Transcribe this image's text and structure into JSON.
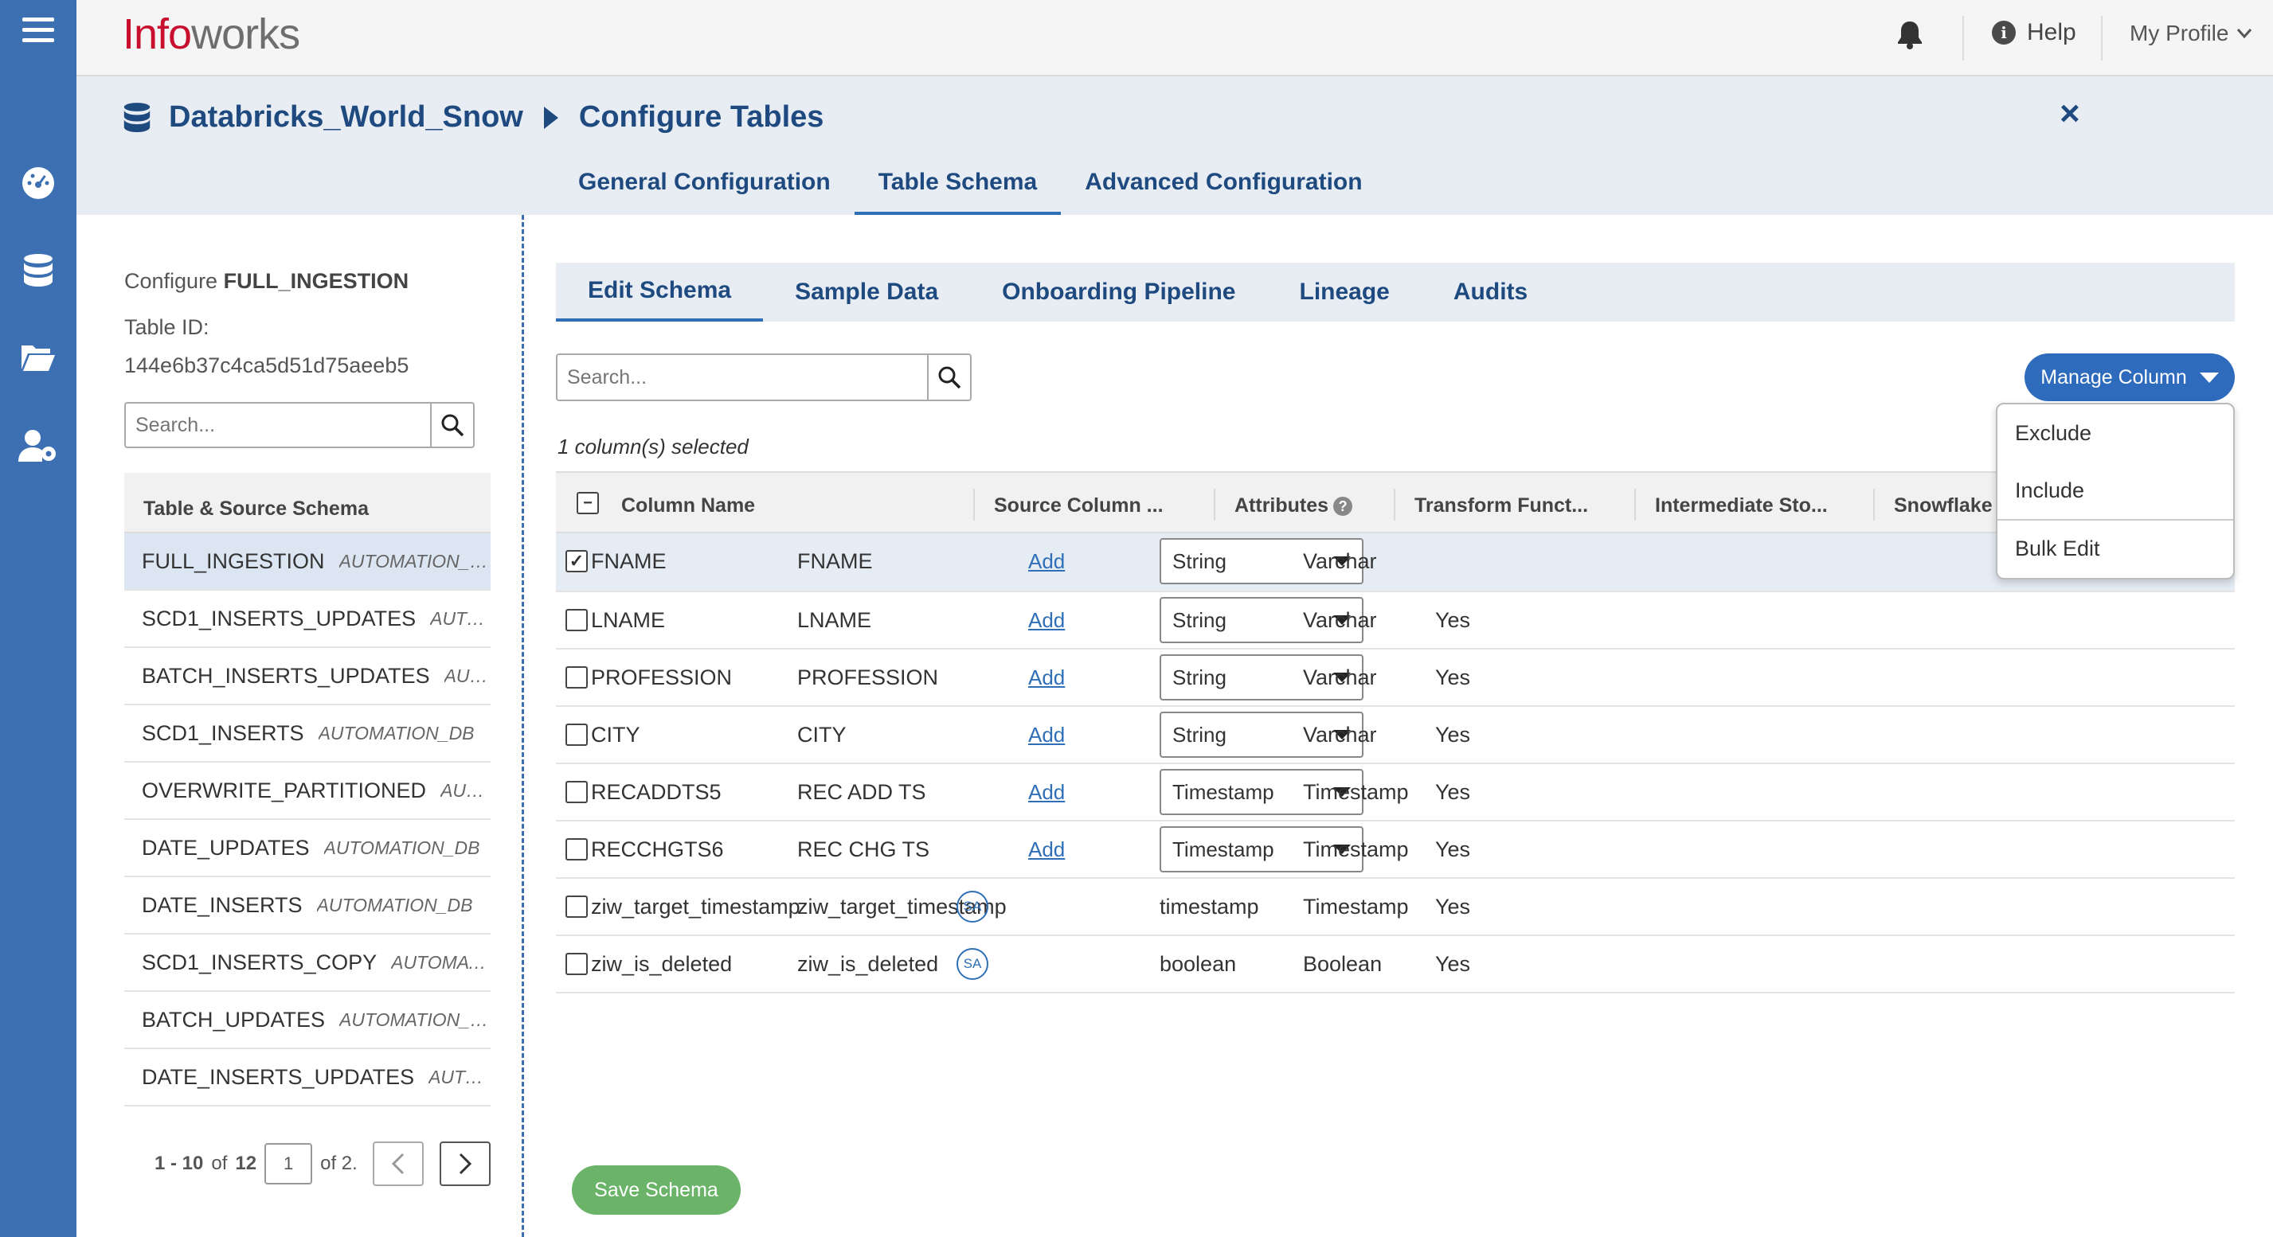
{
  "app": {
    "logo_prefix": "Info",
    "logo_suffix": "works",
    "help_label": "Help",
    "profile_label": "My Profile"
  },
  "breadcrumb": {
    "source": "Databricks_World_Snow",
    "page": "Configure Tables",
    "close": "×"
  },
  "top_tabs": [
    "General Configuration",
    "Table Schema",
    "Advanced Configuration"
  ],
  "left_panel": {
    "configure_prefix": "Configure",
    "configure_table": "FULL_INGESTION",
    "table_id_label": "Table ID:",
    "table_id_value": "144e6b37c4ca5d51d75aeeb5",
    "search_placeholder": "Search...",
    "list_header": "Table & Source Schema",
    "items": [
      {
        "name": "FULL_INGESTION",
        "schema": "AUTOMATION_DB"
      },
      {
        "name": "SCD1_INSERTS_UPDATES",
        "schema": "AUTOMATION_DB"
      },
      {
        "name": "BATCH_INSERTS_UPDATES",
        "schema": "AUTOMATION_DB"
      },
      {
        "name": "SCD1_INSERTS",
        "schema": "AUTOMATION_DB"
      },
      {
        "name": "OVERWRITE_PARTITIONED",
        "schema": "AUTOMATION_DB"
      },
      {
        "name": "DATE_UPDATES",
        "schema": "AUTOMATION_DB"
      },
      {
        "name": "DATE_INSERTS",
        "schema": "AUTOMATION_DB"
      },
      {
        "name": "SCD1_INSERTS_COPY",
        "schema": "AUTOMATION_DB"
      },
      {
        "name": "BATCH_UPDATES",
        "schema": "AUTOMATION_DB"
      },
      {
        "name": "DATE_INSERTS_UPDATES",
        "schema": "AUTOMATION_DB"
      }
    ],
    "pager": {
      "range": "1 - 10",
      "of_word": "of",
      "total": "12",
      "page_input": "1",
      "of_pages": "of 2."
    }
  },
  "sub_tabs": [
    "Edit Schema",
    "Sample Data",
    "Onboarding Pipeline",
    "Lineage",
    "Audits"
  ],
  "main": {
    "search_placeholder": "Search...",
    "manage_column_label": "Manage Column",
    "selected_info": "1 column(s) selected",
    "columns": [
      "Column Name",
      "Source Column ...",
      "Attributes",
      "Transform Funct...",
      "Intermediate Sto...",
      "Snowflake"
    ],
    "rows": [
      {
        "checked": true,
        "name": "FNAME",
        "source": "FNAME",
        "attr": "",
        "transform": "Add",
        "intermediate": "String",
        "intermediate_select": true,
        "snowflake": "Varchar",
        "flag": ""
      },
      {
        "checked": false,
        "name": "LNAME",
        "source": "LNAME",
        "attr": "",
        "transform": "Add",
        "intermediate": "String",
        "intermediate_select": true,
        "snowflake": "Varchar",
        "flag": "Yes"
      },
      {
        "checked": false,
        "name": "PROFESSION",
        "source": "PROFESSION",
        "attr": "",
        "transform": "Add",
        "intermediate": "String",
        "intermediate_select": true,
        "snowflake": "Varchar",
        "flag": "Yes"
      },
      {
        "checked": false,
        "name": "CITY",
        "source": "CITY",
        "attr": "",
        "transform": "Add",
        "intermediate": "String",
        "intermediate_select": true,
        "snowflake": "Varchar",
        "flag": "Yes"
      },
      {
        "checked": false,
        "name": "RECADDTS5",
        "source": "REC ADD TS",
        "attr": "",
        "transform": "Add",
        "intermediate": "Timestamp",
        "intermediate_select": true,
        "snowflake": "Timestamp",
        "flag": "Yes"
      },
      {
        "checked": false,
        "name": "RECCHGTS6",
        "source": "REC CHG TS",
        "attr": "",
        "transform": "Add",
        "intermediate": "Timestamp",
        "intermediate_select": true,
        "snowflake": "Timestamp",
        "flag": "Yes"
      },
      {
        "checked": false,
        "name": "ziw_target_timestamp",
        "source": "ziw_target_timestamp",
        "attr": "SA",
        "transform": "",
        "intermediate": "timestamp",
        "intermediate_select": false,
        "snowflake": "Timestamp",
        "flag": "Yes"
      },
      {
        "checked": false,
        "name": "ziw_is_deleted",
        "source": "ziw_is_deleted",
        "attr": "SA",
        "transform": "",
        "intermediate": "boolean",
        "intermediate_select": false,
        "snowflake": "Boolean",
        "flag": "Yes"
      }
    ],
    "dropdown_items": [
      "Exclude",
      "Include",
      "Bulk Edit"
    ],
    "save_label": "Save Schema"
  }
}
